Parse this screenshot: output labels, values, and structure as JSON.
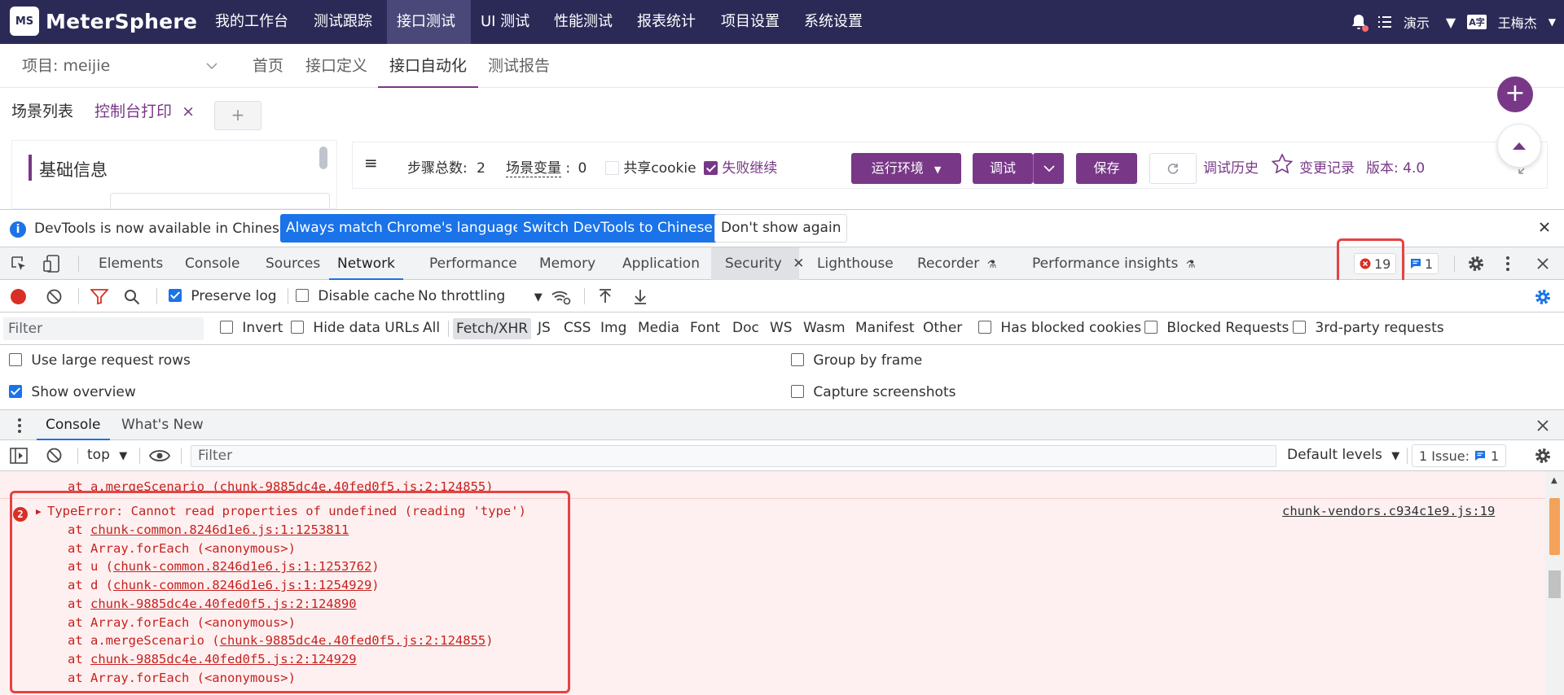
{
  "app": {
    "logo_text": "MeterSphere",
    "logo_mark": "MS",
    "nav": [
      "我的工作台",
      "测试跟踪",
      "接口测试",
      "UI 测试",
      "性能测试",
      "报表统计",
      "项目设置",
      "系统设置"
    ],
    "nav_active": 2,
    "workspace": "演示",
    "user": "王梅杰",
    "lang_icon": "A字"
  },
  "subnav": {
    "project": "项目: meijie",
    "tabs": [
      "首页",
      "接口定义",
      "接口自动化",
      "测试报告"
    ],
    "active": 2
  },
  "tabs": {
    "scene_list": "场景列表",
    "current": "控制台打印",
    "close": "×",
    "add": "+"
  },
  "base_info": {
    "title": "基础信息"
  },
  "toolbar": {
    "menu": "≡",
    "steps_label": "步骤总数:",
    "steps_value": "2",
    "vars_label": "场景变量",
    "vars_value": "0",
    "share_cookie": "共享cookie",
    "continue_on_fail": "失败继续",
    "env_button": "运行环境",
    "debug_button": "调试",
    "save_button": "保存",
    "history_link": "调试历史",
    "changes_link": "变更记录",
    "version": "版本: 4.0"
  },
  "fab": {
    "add": "+"
  },
  "devtools": {
    "infobar": {
      "message": "DevTools is now available in Chinese!",
      "btn_match": "Always match Chrome's language",
      "btn_switch": "Switch DevTools to Chinese",
      "btn_dismiss": "Don't show again",
      "info_glyph": "i"
    },
    "tabs": [
      "Elements",
      "Console",
      "Sources",
      "Network",
      "Performance",
      "Memory",
      "Application",
      "Security",
      "Lighthouse",
      "Recorder",
      "Performance insights"
    ],
    "active_tab": "Network",
    "error_count": "19",
    "message_count": "1",
    "network": {
      "preserve_log": "Preserve log",
      "disable_cache": "Disable cache",
      "throttling": "No throttling"
    },
    "filter": {
      "placeholder": "Filter",
      "invert": "Invert",
      "hide_data_urls": "Hide data URLs",
      "types": [
        "All",
        "Fetch/XHR",
        "JS",
        "CSS",
        "Img",
        "Media",
        "Font",
        "Doc",
        "WS",
        "Wasm",
        "Manifest",
        "Other"
      ],
      "selected_type": "Fetch/XHR",
      "has_blocked_cookies": "Has blocked cookies",
      "blocked_requests": "Blocked Requests",
      "third_party": "3rd-party requests"
    },
    "settings": {
      "large_rows": "Use large request rows",
      "show_overview": "Show overview",
      "group_by_frame": "Group by frame",
      "capture_screenshots": "Capture screenshots"
    },
    "drawer": {
      "tabs": [
        "Console",
        "What's New"
      ],
      "active": "Console",
      "context": "top",
      "filter_placeholder": "Filter",
      "levels": "Default levels",
      "issues_label": "1 Issue:",
      "issues_count": "1"
    },
    "console": {
      "prev_line": "at a.mergeScenario (chunk-9885dc4e.40fed0f5.js:2:124855)",
      "error_badge": "2",
      "error_message": "TypeError: Cannot read properties of undefined (reading 'type')",
      "source": "chunk-vendors.c934c1e9.js:19",
      "stack": [
        {
          "pre": "at ",
          "link": "chunk-common.8246d1e6.js:1:1253811",
          "post": ""
        },
        {
          "pre": "at Array.forEach (<anonymous>)",
          "link": "",
          "post": ""
        },
        {
          "pre": "at u (",
          "link": "chunk-common.8246d1e6.js:1:1253762",
          "post": ")"
        },
        {
          "pre": "at d (",
          "link": "chunk-common.8246d1e6.js:1:1254929",
          "post": ")"
        },
        {
          "pre": "at ",
          "link": "chunk-9885dc4e.40fed0f5.js:2:124890",
          "post": ""
        },
        {
          "pre": "at Array.forEach (<anonymous>)",
          "link": "",
          "post": ""
        },
        {
          "pre": "at a.mergeScenario (",
          "link": "chunk-9885dc4e.40fed0f5.js:2:124855",
          "post": ")"
        },
        {
          "pre": "at ",
          "link": "chunk-9885dc4e.40fed0f5.js:2:124929",
          "post": ""
        },
        {
          "pre": "at Array.forEach (<anonymous>)",
          "link": "",
          "post": ""
        }
      ]
    }
  },
  "colors": {
    "brand": "#783887",
    "nav_bg": "#2b2a57",
    "devtools_blue": "#1a73e8",
    "error_red": "#c5221f",
    "highlight": "#e54343"
  }
}
